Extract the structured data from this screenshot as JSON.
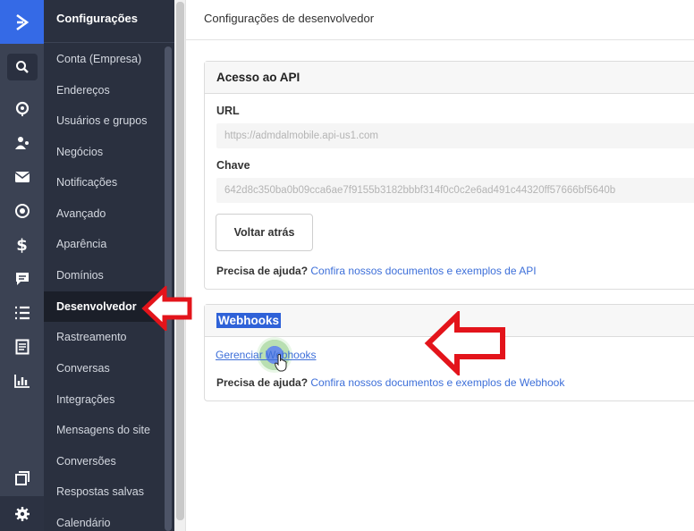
{
  "rail": {
    "icons": [
      "logo-chevron-icon",
      "search-icon",
      "pin-icon",
      "contacts-icon",
      "mail-icon",
      "target-icon",
      "dollar-icon",
      "chat-icon",
      "list-icon",
      "document-icon",
      "chart-icon",
      "windows-icon",
      "gear-icon"
    ]
  },
  "sidebar": {
    "title": "Configurações",
    "items": [
      {
        "label": "Conta (Empresa)"
      },
      {
        "label": "Endereços"
      },
      {
        "label": "Usuários e grupos"
      },
      {
        "label": "Negócios"
      },
      {
        "label": "Notificações"
      },
      {
        "label": "Avançado"
      },
      {
        "label": "Aparência"
      },
      {
        "label": "Domínios"
      },
      {
        "label": "Desenvolvedor",
        "active": true
      },
      {
        "label": "Rastreamento"
      },
      {
        "label": "Conversas"
      },
      {
        "label": "Integrações"
      },
      {
        "label": "Mensagens do site"
      },
      {
        "label": "Conversões"
      },
      {
        "label": "Respostas salvas"
      },
      {
        "label": "Calendário"
      }
    ]
  },
  "header": {
    "title": "Configurações de desenvolvedor"
  },
  "api_card": {
    "title": "Acesso ao API",
    "url_label": "URL",
    "url_value": "https://admdalmobile.api-us1.com",
    "key_label": "Chave",
    "key_value": "642d8c350ba0b09cca6ae7f9155b3182bbbf314f0c0c2e6ad491c44320ff57666bf5640b",
    "back_button": "Voltar atrás",
    "help_prefix": "Precisa de ajuda?",
    "help_link": "Confira nossos documentos e exemplos de API"
  },
  "webhook_card": {
    "title": "Webhooks",
    "manage_link": "Gerenciar Webhooks",
    "help_prefix": "Precisa de ajuda?",
    "help_link": "Confira nossos documentos e exemplos de Webhook"
  },
  "colors": {
    "accent": "#356ae6",
    "rail_bg": "#3b4253",
    "sidebar_bg": "#2a303f",
    "link": "#3d6fd9",
    "annotation_arrow": "#e3141b"
  }
}
